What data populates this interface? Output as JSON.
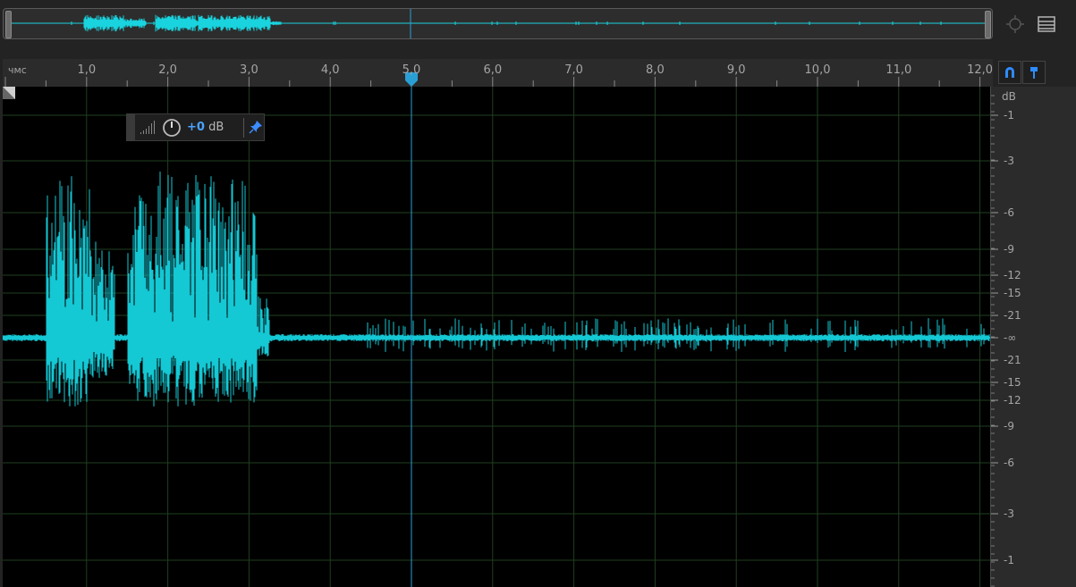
{
  "overview": {
    "name": "waveform-overview",
    "accent": "#19d3de"
  },
  "toolbar": {
    "zoom_icon": "zoom-navigator-icon",
    "menu_icon": "panel-menu-icon",
    "snap_icon": "snap-magnet-icon",
    "marker_icon": "marker-pin-icon"
  },
  "ruler": {
    "unit": "чмс",
    "ticks": [
      {
        "time": 1,
        "label": "1,0"
      },
      {
        "time": 2,
        "label": "2,0"
      },
      {
        "time": 3,
        "label": "3,0"
      },
      {
        "time": 4,
        "label": "4,0"
      },
      {
        "time": 5,
        "label": "5,0"
      },
      {
        "time": 6,
        "label": "6,0"
      },
      {
        "time": 7,
        "label": "7,0"
      },
      {
        "time": 8,
        "label": "8,0"
      },
      {
        "time": 9,
        "label": "9,0"
      },
      {
        "time": 10,
        "label": "10,0"
      },
      {
        "time": 11,
        "label": "11,0"
      },
      {
        "time": 12,
        "label": "12,0"
      }
    ],
    "visible_range_seconds": [
      0,
      12.1
    ],
    "playhead_time": 5.0
  },
  "hud": {
    "value_number": "+0",
    "value_unit": " dB",
    "knob_icon": "volume-knob-icon",
    "meter_icon": "level-meter-icon",
    "pin_icon": "pin-icon"
  },
  "db_scale": {
    "unit": "dB",
    "labels_top": [
      "-1",
      "-3",
      "-6",
      "-9",
      "-12",
      "-15",
      "-21"
    ],
    "center": "-∞",
    "labels_bottom": [
      "-21",
      "-15",
      "-12",
      "-9",
      "-6",
      "-3",
      "-1"
    ]
  },
  "colors": {
    "waveform": "#14c8d4",
    "playhead": "#2a9fd6",
    "grid": "#1f3f1f",
    "background": "#000000",
    "accent_blue": "#3b8cff"
  }
}
